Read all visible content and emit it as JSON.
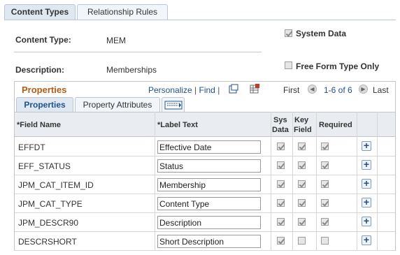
{
  "tabs": {
    "content_types": "Content Types",
    "relationship_rules": "Relationship Rules"
  },
  "form": {
    "content_type_label": "Content Type:",
    "content_type_value": "MEM",
    "description_label": "Description:",
    "description_value": "Memberships",
    "system_data_label": "System Data",
    "system_data_checked": true,
    "free_form_label": "Free Form Type Only",
    "free_form_checked": false
  },
  "grid": {
    "title": "Properties",
    "personalize": "Personalize",
    "sep": "|",
    "find": "Find",
    "first": "First",
    "range": "1-6 of 6",
    "last": "Last",
    "subtabs": {
      "properties": "Properties",
      "property_attributes": "Property Attributes"
    },
    "headers": {
      "field_name": "*Field Name",
      "label_text": "*Label Text",
      "sys_data_1": "Sys",
      "sys_data_2": "Data",
      "key_field_1": "Key",
      "key_field_2": "Field",
      "required": "Required"
    },
    "rows": [
      {
        "field": "EFFDT",
        "label": "Effective Date",
        "sys": true,
        "key": true,
        "req": true
      },
      {
        "field": "EFF_STATUS",
        "label": "Status",
        "sys": true,
        "key": true,
        "req": true
      },
      {
        "field": "JPM_CAT_ITEM_ID",
        "label": "Membership",
        "sys": true,
        "key": true,
        "req": true
      },
      {
        "field": "JPM_CAT_TYPE",
        "label": "Content Type",
        "sys": true,
        "key": true,
        "req": true
      },
      {
        "field": "JPM_DESCR90",
        "label": "Description",
        "sys": true,
        "key": true,
        "req": true
      },
      {
        "field": "DESCRSHORT",
        "label": "Short Description",
        "sys": true,
        "key": false,
        "req": false
      }
    ],
    "add_symbol": "+"
  }
}
